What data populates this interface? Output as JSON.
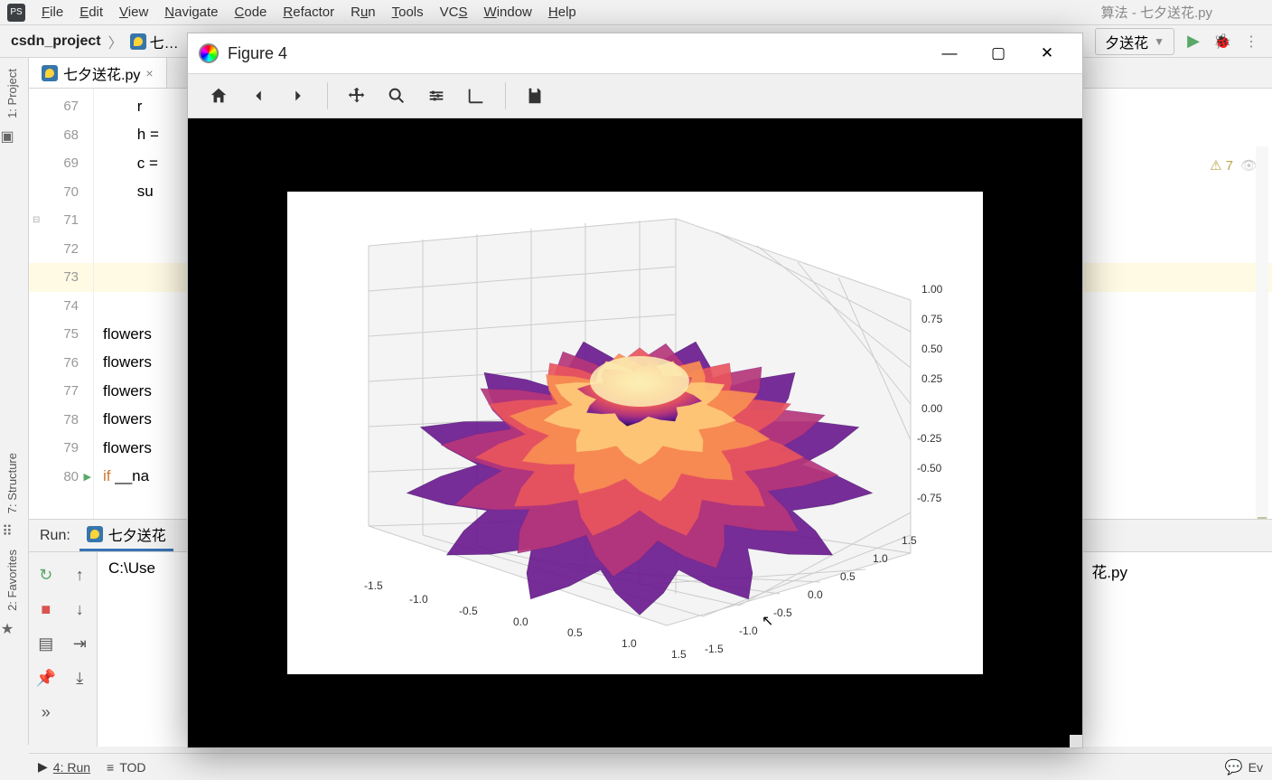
{
  "menubar": {
    "items": [
      "File",
      "Edit",
      "View",
      "Navigate",
      "Code",
      "Refactor",
      "Run",
      "Tools",
      "VCS",
      "Window",
      "Help"
    ],
    "title_hint": "算法 - 七夕送花.py"
  },
  "breadcrumb": {
    "project": "csdn_project",
    "file": "七…",
    "run_config": "夕送花",
    "run_file_ext": ".py"
  },
  "editor": {
    "tab": "七夕送花.py",
    "lines": [
      {
        "num": 67,
        "text": "        r"
      },
      {
        "num": 68,
        "text": "        h ="
      },
      {
        "num": 69,
        "text": "        c ="
      },
      {
        "num": 70,
        "text": "        su"
      },
      {
        "num": 71,
        "text": ""
      },
      {
        "num": 72,
        "text": ""
      },
      {
        "num": 73,
        "text": "",
        "active": true
      },
      {
        "num": 74,
        "text": ""
      },
      {
        "num": 75,
        "text": "flowers"
      },
      {
        "num": 76,
        "text": "flowers"
      },
      {
        "num": 77,
        "text": "flowers"
      },
      {
        "num": 78,
        "text": "flowers"
      },
      {
        "num": 79,
        "text": "flowers"
      },
      {
        "num": 80,
        "text": "if __na",
        "run": true
      }
    ],
    "warnings": "7"
  },
  "run": {
    "label": "Run:",
    "tab": "七夕送花",
    "console": "C:\\Use",
    "console_tail": "花.py"
  },
  "bottom": {
    "run": "4: Run",
    "todo": "TOD",
    "event": "Ev"
  },
  "left_strip": {
    "project": "1: Project",
    "structure": "7: Structure",
    "favorites": "2: Favorites"
  },
  "figure": {
    "title": "Figure 4"
  },
  "chart_data": {
    "type": "3d-surface",
    "title": "",
    "x_ticks": [
      "-1.5",
      "-1.0",
      "-0.5",
      "0.0",
      "0.5",
      "1.0",
      "1.5"
    ],
    "y_ticks": [
      "-1.5",
      "-1.0",
      "-0.5",
      "0.0",
      "0.5",
      "1.0",
      "1.5"
    ],
    "z_ticks": [
      "-0.75",
      "-0.50",
      "-0.25",
      "0.00",
      "0.25",
      "0.50",
      "0.75",
      "1.00"
    ],
    "xlim": [
      -1.7,
      1.7
    ],
    "ylim": [
      -1.7,
      1.7
    ],
    "zlim": [
      -0.8,
      1.05
    ],
    "description": "Layered 3D rose/flower surface; multiple petal layers; colormap roughly magma/plasma-like from dark purple at bottom through magenta/red to orange/yellow at top center.",
    "color_stops": [
      "#2d0a4e",
      "#6a1b8f",
      "#b5367a",
      "#e8555d",
      "#f98e52",
      "#fdc97a",
      "#fbeeb6"
    ]
  }
}
